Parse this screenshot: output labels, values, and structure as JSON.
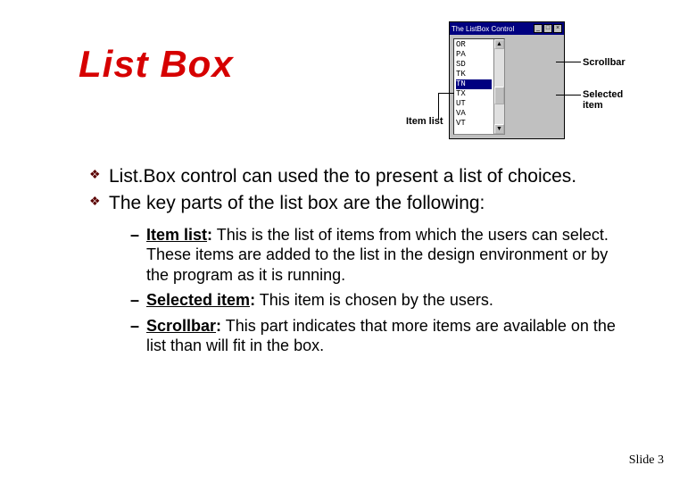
{
  "title": "List Box",
  "illustration": {
    "window_title": "The ListBox Control",
    "items": [
      "OR",
      "PA",
      "SD",
      "TK",
      "TN",
      "TX",
      "UT",
      "VA",
      "VT"
    ],
    "selected_index": 4,
    "callouts": {
      "scrollbar": "Scrollbar",
      "selected_item": "Selected item",
      "item_list": "Item list"
    }
  },
  "bullets": [
    "List.Box control can used the to present a list of choices.",
    "The key parts of the list box are the following:"
  ],
  "sub_bullets": [
    {
      "term": "Item list",
      "text": "This is the list of items from which the users can select. These items are added to the list in the design environment or by the program as it is running."
    },
    {
      "term": "Selected item",
      "text": "This item is chosen by the users."
    },
    {
      "term": "Scrollbar",
      "text": "This part indicates that more items are available on the list than will fit in the box."
    }
  ],
  "footer": {
    "slide_label": "Slide 3"
  }
}
